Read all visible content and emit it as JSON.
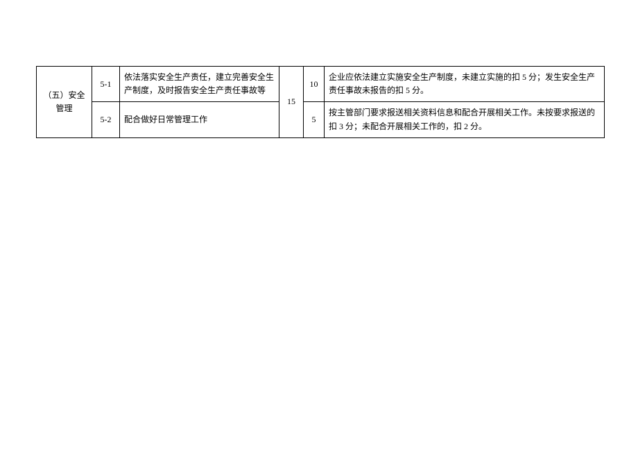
{
  "table": {
    "category": "（五）安全管理",
    "total_score": "15",
    "rows": [
      {
        "code": "5-1",
        "description": "依法落实安全生产责任，建立完善安全生产制度，及时报告安全生产责任事故等",
        "score": "10",
        "criteria": "企业应依法建立实施安全生产制度，未建立实施的扣 5 分；发生安全生产责任事故未报告的扣 5 分。"
      },
      {
        "code": "5-2",
        "description": "配合做好日常管理工作",
        "score": "5",
        "criteria": "按主管部门要求报送相关资料信息和配合开展相关工作。未按要求报送的扣 3 分；未配合开展相关工作的，扣 2 分。"
      }
    ]
  }
}
